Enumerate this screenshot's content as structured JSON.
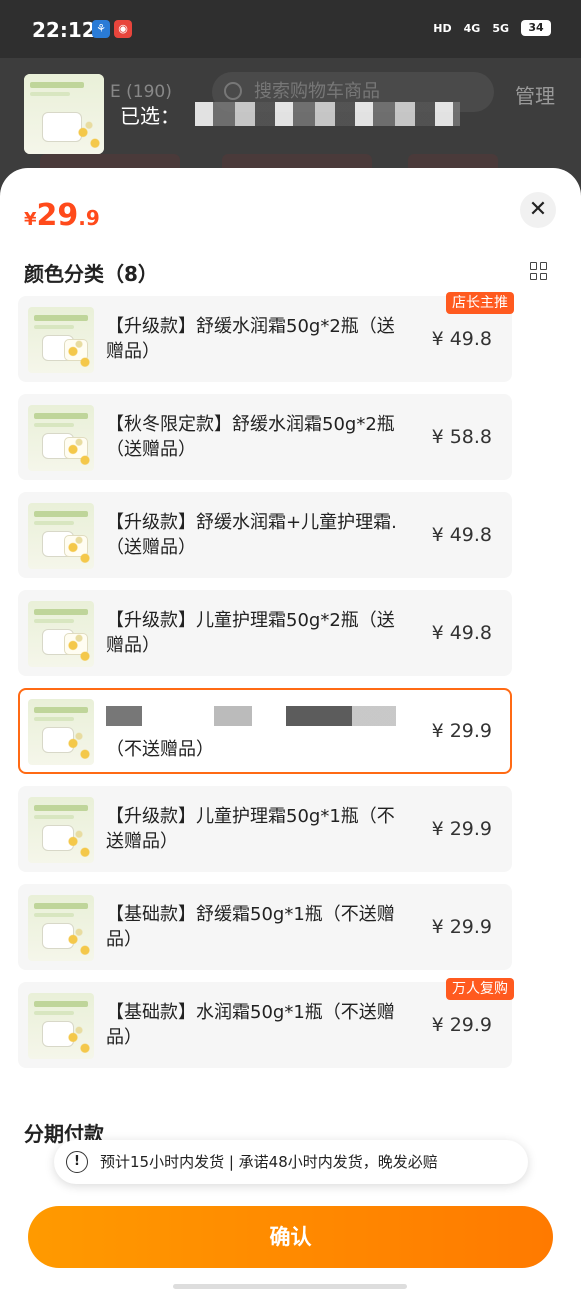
{
  "status_bar": {
    "time": "22:12",
    "network_1": "4G",
    "network_2": "5G",
    "battery": "34"
  },
  "background": {
    "cart_count": "E (190)",
    "search_placeholder": "搜索购物车商品",
    "manage_label": "管理",
    "selected_label": "已选："
  },
  "sheet": {
    "price_symbol": "¥",
    "price_main": "29",
    "price_decimal": ".9",
    "close_label": "✕",
    "section_title": "颜色分类（8）",
    "options": [
      {
        "name": "【升级款】舒缓水润霜50g*2瓶（送赠品）",
        "price": "¥ 49.8",
        "tag": "店长主推"
      },
      {
        "name": "【秋冬限定款】舒缓水润霜50g*2瓶（送赠品）",
        "price": "¥ 58.8",
        "tag": ""
      },
      {
        "name": "【升级款】舒缓水润霜+儿童护理霜.（送赠品）",
        "price": "¥ 49.8",
        "tag": ""
      },
      {
        "name": "【升级款】儿童护理霜50g*2瓶（送赠品）",
        "price": "¥ 49.8",
        "tag": ""
      },
      {
        "name": "（不送赠品）",
        "price": "¥ 29.9",
        "tag": ""
      },
      {
        "name": "【升级款】儿童护理霜50g*1瓶（不送赠品）",
        "price": "¥ 29.9",
        "tag": ""
      },
      {
        "name": "【基础款】舒缓霜50g*1瓶（不送赠品）",
        "price": "¥ 29.9",
        "tag": ""
      },
      {
        "name": "【基础款】水润霜50g*1瓶（不送赠品）",
        "price": "¥ 29.9",
        "tag": "万人复购"
      }
    ],
    "installment_title": "分期付款",
    "ship_icon": "!",
    "ship_tip": "预计15小时内发货 | 承诺48小时内发货，晚发必赔",
    "confirm_label": "确认"
  },
  "colors": {
    "accent": "#ff4a1b",
    "button": "#ff8a00",
    "selected_border": "#ff6a14"
  }
}
